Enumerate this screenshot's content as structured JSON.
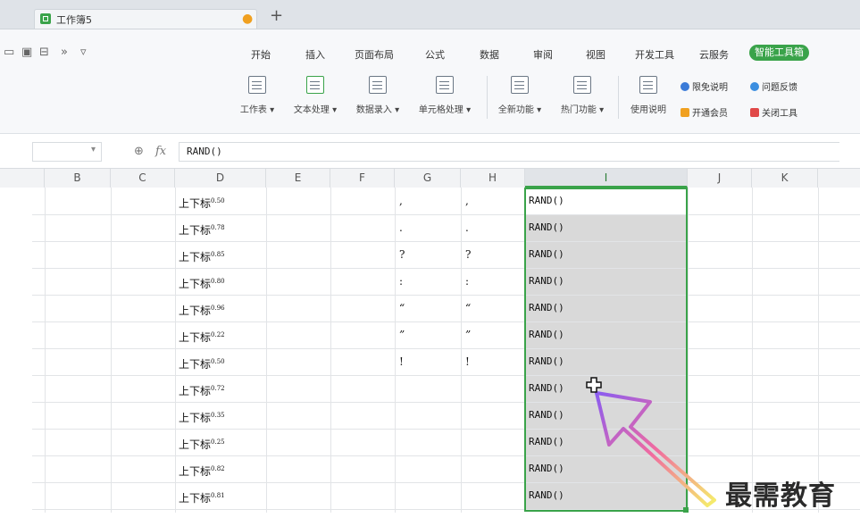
{
  "tab": {
    "title": "工作簿5",
    "new_tab": "+"
  },
  "quick_access": [
    "open-icon",
    "save-icon",
    "print-icon",
    "more-icon",
    "dropdown-icon"
  ],
  "menu": {
    "items": [
      "开始",
      "插入",
      "页面布局",
      "公式",
      "数据",
      "审阅",
      "视图",
      "开发工具",
      "云服务"
    ],
    "smart_tools": "智能工具箱"
  },
  "ribbon": {
    "buttons": [
      "工作表",
      "文本处理",
      "数据录入",
      "单元格处理",
      "全新功能",
      "热门功能",
      "使用说明"
    ],
    "small": [
      "限免说明",
      "问题反馈",
      "开通会员",
      "关闭工具"
    ]
  },
  "formula_bar": {
    "name_box": "",
    "fx": "fx",
    "formula": "RAND()"
  },
  "columns": [
    "B",
    "C",
    "D",
    "E",
    "F",
    "G",
    "H",
    "I",
    "J",
    "K"
  ],
  "active_column": "I",
  "rows": [
    {
      "d_text": "上下标",
      "d_sup": "0.50",
      "g": ",",
      "h": ",",
      "i": "RAND()"
    },
    {
      "d_text": "上下标",
      "d_sup": "0.78",
      "g": ".",
      "h": ".",
      "i": "RAND()"
    },
    {
      "d_text": "上下标",
      "d_sup": "0.85",
      "g": "?",
      "h": "?",
      "i": "RAND()"
    },
    {
      "d_text": "上下标",
      "d_sup": "0.80",
      "g": ":",
      "h": ":",
      "i": "RAND()"
    },
    {
      "d_text": "上下标",
      "d_sup": "0.96",
      "g": "“",
      "h": "“",
      "i": "RAND()"
    },
    {
      "d_text": "上下标",
      "d_sup": "0.22",
      "g": "”",
      "h": "”",
      "i": "RAND()"
    },
    {
      "d_text": "上下标",
      "d_sup": "0.50",
      "g": "!",
      "h": "!",
      "i": "RAND()"
    },
    {
      "d_text": "上下标",
      "d_sup": "0.72",
      "g": "",
      "h": "",
      "i": "RAND()"
    },
    {
      "d_text": "上下标",
      "d_sup": "0.35",
      "g": "",
      "h": "",
      "i": "RAND()"
    },
    {
      "d_text": "上下标",
      "d_sup": "0.25",
      "g": "",
      "h": "",
      "i": "RAND()"
    },
    {
      "d_text": "上下标",
      "d_sup": "0.82",
      "g": "",
      "h": "",
      "i": "RAND()"
    },
    {
      "d_text": "上下标",
      "d_sup": "0.81",
      "g": "",
      "h": "",
      "i": "RAND()"
    }
  ],
  "watermark": "最需教育",
  "colors": {
    "accent": "#3aa34a",
    "selection": "#d9d9d9"
  }
}
